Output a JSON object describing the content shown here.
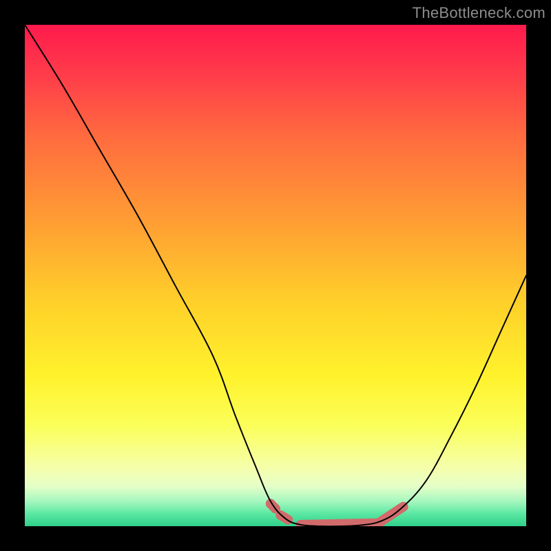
{
  "attribution": "TheBottleneck.com",
  "chart_data": {
    "type": "line",
    "title": "",
    "xlabel": "",
    "ylabel": "",
    "xlim": [
      0,
      100
    ],
    "ylim": [
      0,
      100
    ],
    "series": [
      {
        "name": "bottleneck-curve",
        "x": [
          0,
          7.5,
          15,
          22.5,
          30,
          37.5,
          42,
          46,
          49,
          52,
          55,
          59,
          63,
          67,
          71,
          75,
          80,
          85,
          90,
          95,
          100
        ],
        "values": [
          100,
          88,
          75,
          62,
          48,
          34,
          22,
          12,
          5,
          1.5,
          0.3,
          0,
          0,
          0.2,
          1,
          3.5,
          9,
          18,
          28,
          39,
          50
        ]
      }
    ],
    "highlight_segments": [
      {
        "name": "marker-dot-1",
        "x0": 49.0,
        "y0": 4.5,
        "x1": 50.0,
        "y1": 3.5
      },
      {
        "name": "marker-dot-2",
        "x0": 51.0,
        "y0": 2.2,
        "x1": 52.5,
        "y1": 1.3
      },
      {
        "name": "marker-plateau",
        "x0": 55.0,
        "y0": 0.3,
        "x1": 70.5,
        "y1": 0.6
      },
      {
        "name": "marker-rise",
        "x0": 70.5,
        "y0": 0.6,
        "x1": 75.5,
        "y1": 3.9
      }
    ],
    "colors": {
      "curve": "#000000",
      "highlight": "#d16b6b",
      "gradient_top": "#ff1a4d",
      "gradient_bottom": "#2fd18b"
    }
  }
}
